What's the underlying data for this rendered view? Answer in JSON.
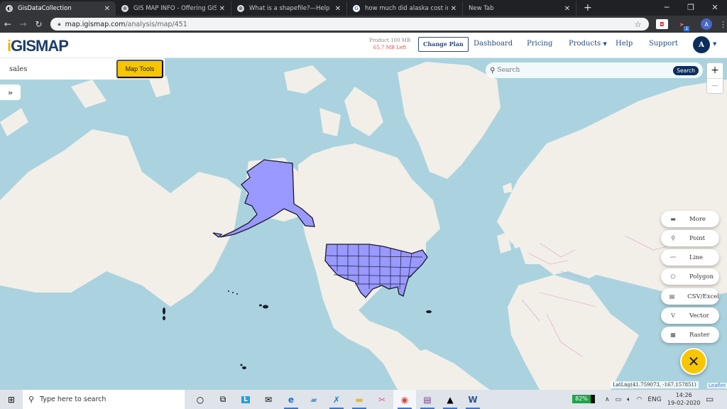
{
  "browser": {
    "tabs": [
      {
        "title": "GisDataCollection",
        "active": true
      },
      {
        "title": "GIS MAP INFO - Offering GIS rel",
        "active": false
      },
      {
        "title": "What is a shapefile?—Help | Arc",
        "active": false
      },
      {
        "title": "how much did alaska cost in tod",
        "active": false
      },
      {
        "title": "New Tab",
        "active": false
      }
    ],
    "new_tab_icon": "+",
    "window_controls": [
      "minimize-icon",
      "maximize-icon",
      "close-icon"
    ],
    "url_host": "map.igismap.com",
    "url_path": "/analysis/map/451",
    "profile_initial": "A",
    "extension_badge": "1"
  },
  "header": {
    "logo_prefix": "i",
    "logo_text": "GISMAP",
    "quota_total": "Product 100 MB",
    "quota_left": "65.7 MB Left",
    "change_plan": "Change Plan",
    "nav": [
      "Dashboard",
      "Pricing",
      "Products",
      "Help",
      "Support"
    ],
    "user_initial": "A"
  },
  "layer_panel": {
    "layer_name": "sales",
    "map_tools_label": "Map Tools",
    "expand_icon": "»"
  },
  "search": {
    "placeholder": "Search",
    "button_label": "Search"
  },
  "zoom": {
    "in": "+",
    "out": "−"
  },
  "tools": [
    {
      "label": "More",
      "icon": "more-icon",
      "glyph": "▬"
    },
    {
      "label": "Point",
      "icon": "map-pin-icon",
      "glyph": "⚲"
    },
    {
      "label": "Line",
      "icon": "line-icon",
      "glyph": "〰"
    },
    {
      "label": "Polygon",
      "icon": "polygon-icon",
      "glyph": "⬠"
    },
    {
      "label": "CSV/Excel",
      "icon": "csv-file-icon",
      "glyph": "▤"
    },
    {
      "label": "Vector",
      "icon": "vector-icon",
      "glyph": "V"
    },
    {
      "label": "Raster",
      "icon": "raster-icon",
      "glyph": "▦"
    }
  ],
  "fab_glyph": "✕",
  "map": {
    "highlighted_layer": "US states",
    "highlight_fill": "#9999ff",
    "highlight_stroke": "#1a1a2e",
    "water_color": "#aad3df",
    "land_color": "#f2efe9",
    "latlng_readout": "LatLng(41.759073, -167.157851)",
    "attribution": "Leaflet"
  },
  "taskbar": {
    "search_placeholder": "Type here to search",
    "battery": "82%",
    "language": "ENG",
    "time": "14:26",
    "date": "19-02-2020"
  }
}
